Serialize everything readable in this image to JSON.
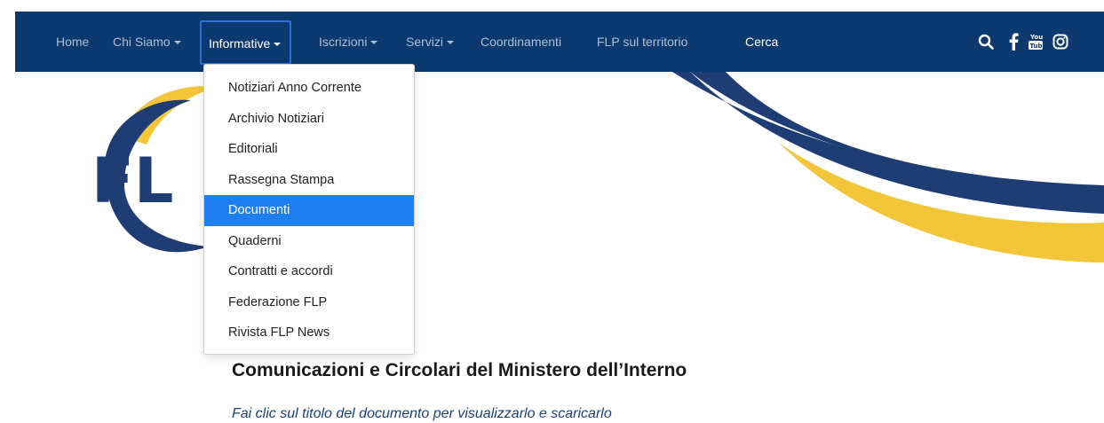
{
  "nav": {
    "items": [
      {
        "label": "Home"
      },
      {
        "label": "Chi Siamo"
      },
      {
        "label": "Informative"
      },
      {
        "label": "Iscrizioni"
      },
      {
        "label": "Servizi"
      },
      {
        "label": "Coordinamenti"
      },
      {
        "label": "FLP sul territorio"
      }
    ],
    "search_label": "Cerca",
    "icons": [
      "search-icon",
      "facebook-icon",
      "youtube-icon",
      "instagram-icon"
    ],
    "bg_color": "#0c3a70"
  },
  "banner": {
    "logo_text": "FLP",
    "logo_blue": "#1f3d75",
    "logo_yellow": "#f3c63a"
  },
  "dropdown": {
    "items": [
      {
        "label": "Notiziari Anno Corrente"
      },
      {
        "label": "Archivio Notiziari"
      },
      {
        "label": "Editoriali"
      },
      {
        "label": "Rassegna Stampa"
      },
      {
        "label": "Documenti"
      },
      {
        "label": "Quaderni"
      },
      {
        "label": "Contratti e accordi"
      },
      {
        "label": "Federazione FLP"
      },
      {
        "label": "Rivista FLP News"
      }
    ],
    "selected": "Documenti",
    "selected_color": "#1e80f0"
  },
  "content": {
    "title": "Comunicazioni e Circolari del Ministero dell’Interno",
    "subtitle": "Fai clic sul titolo del documento per visualizzarlo e scaricarlo"
  }
}
